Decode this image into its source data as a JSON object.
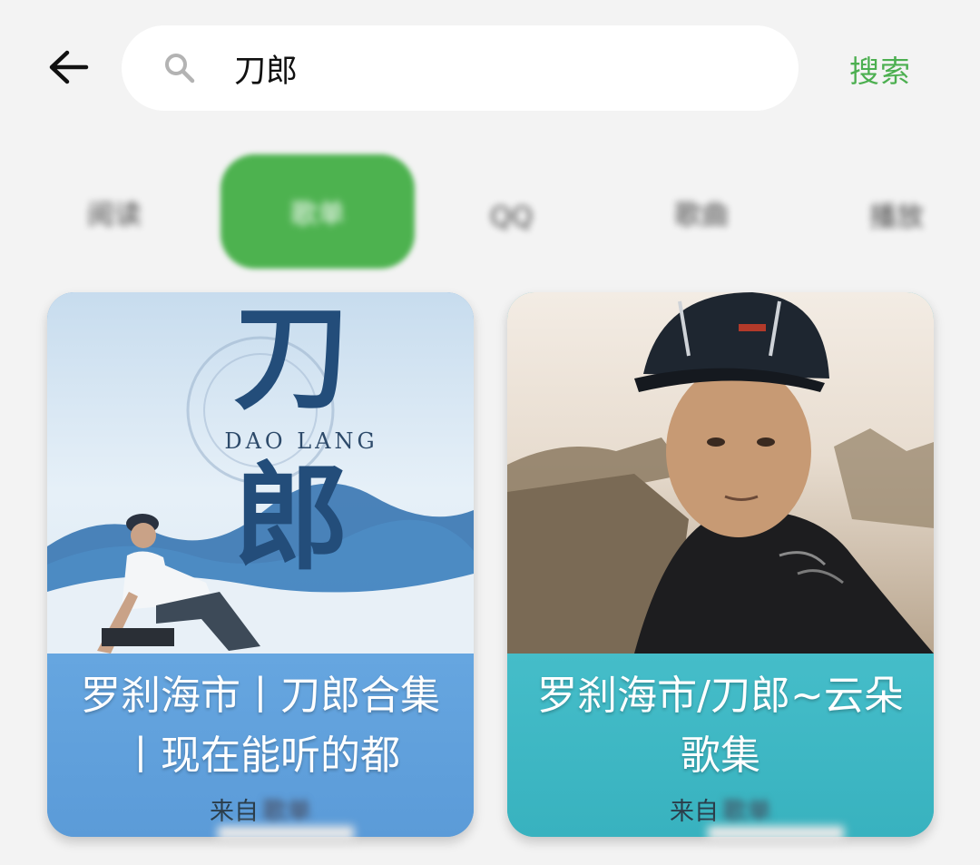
{
  "header": {
    "back_icon": "arrow-left-icon",
    "search": {
      "icon": "search-icon",
      "query": "刀郎"
    },
    "search_button_label": "搜索"
  },
  "tabs": {
    "items": [
      {
        "label": "阅读",
        "blurred": true
      },
      {
        "label": "歌单",
        "blurred": true,
        "active": true
      },
      {
        "label": "QQ",
        "blurred": true
      },
      {
        "label": "歌曲",
        "blurred": true
      },
      {
        "label": "播放",
        "blurred": true
      }
    ],
    "active_color": "#4db24f"
  },
  "cards": [
    {
      "cover_text_big_1": "刀",
      "cover_text_big_2": "郎",
      "cover_text_latin": "DAO LANG",
      "title": "罗刹海市丨刀郎合集丨现在能听的都",
      "source_prefix": "来自",
      "source_name": "歌单",
      "caption_color": "#5fa0dc"
    },
    {
      "title": "罗刹海市/刀郎~云朵 歌集",
      "source_prefix": "来自",
      "source_name": "歌单",
      "caption_color": "#3cb8c6"
    }
  ],
  "colors": {
    "accent": "#4caf50",
    "background": "#f3f3f3"
  }
}
